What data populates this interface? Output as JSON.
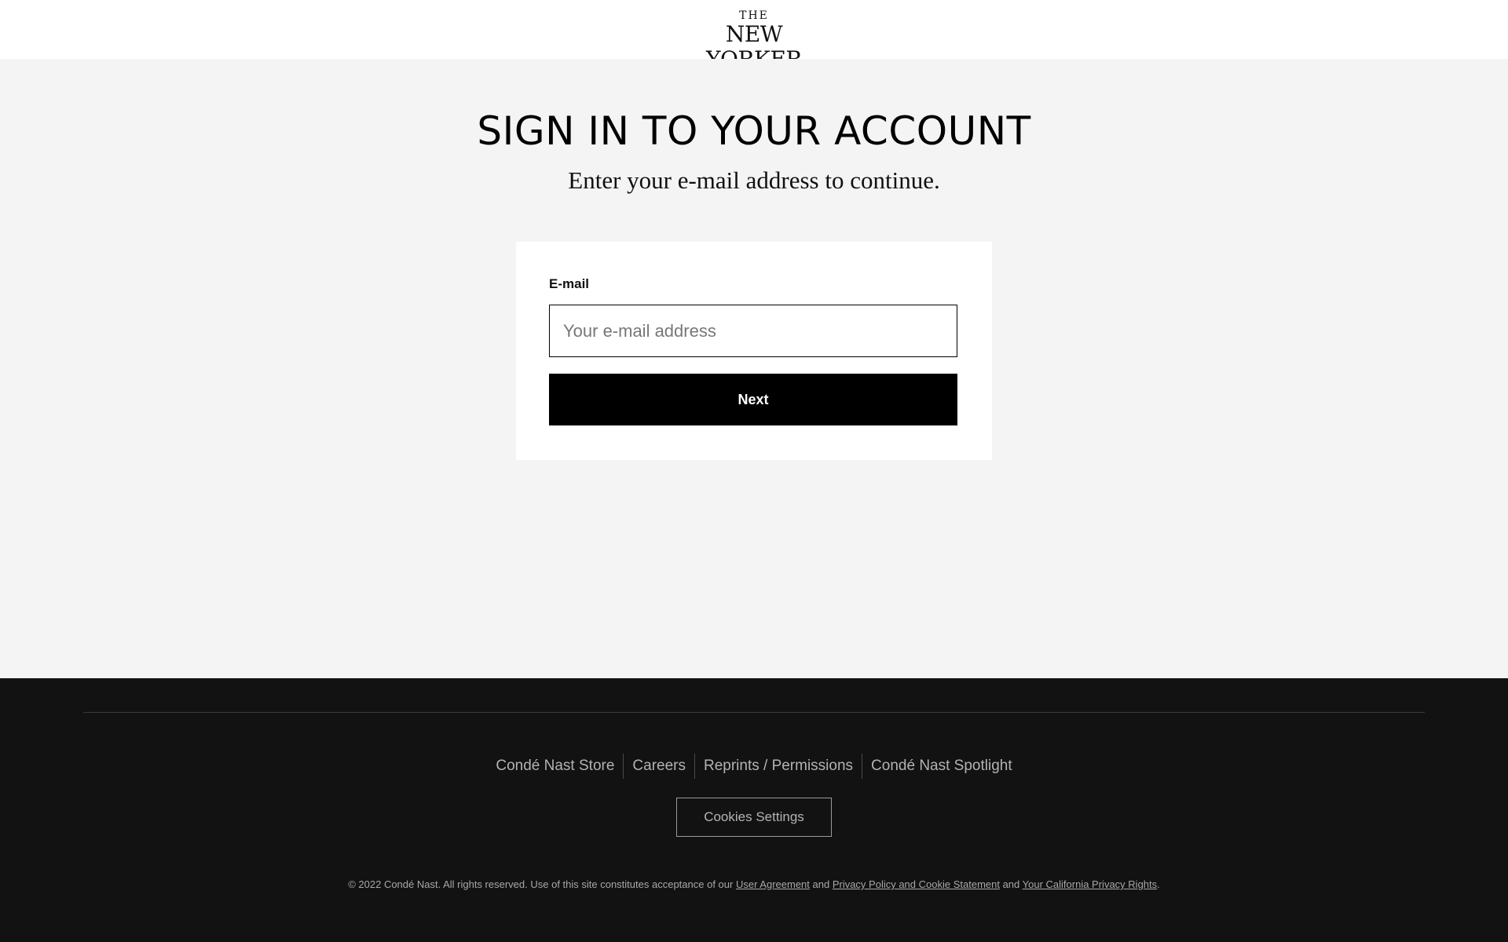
{
  "header": {
    "logo_top": "THE",
    "logo_name": "NEW YORKER"
  },
  "main": {
    "title": "SIGN IN TO YOUR ACCOUNT",
    "subtitle": "Enter your e-mail address to continue."
  },
  "form": {
    "email_label": "E-mail",
    "email_value": "",
    "email_placeholder": "Your e-mail address",
    "next_label": "Next"
  },
  "footer": {
    "links": [
      {
        "label": "Condé Nast Store"
      },
      {
        "label": "Careers"
      },
      {
        "label": "Reprints / Permissions"
      },
      {
        "label": "Condé Nast Spotlight"
      }
    ],
    "cookies_label": "Cookies Settings",
    "legal": {
      "prefix": "© 2022 Condé Nast. All rights reserved. Use of this site constitutes acceptance of our ",
      "link1": "User Agreement",
      "and1": " and ",
      "link2": "Privacy Policy and Cookie Statement",
      "and2": " and ",
      "link3": "Your California Privacy Rights",
      "suffix": "."
    }
  },
  "colors": {
    "page_bg": "#f4f4f4",
    "footer_bg": "#121212",
    "button_bg": "#000000",
    "button_text": "#ffffff"
  }
}
